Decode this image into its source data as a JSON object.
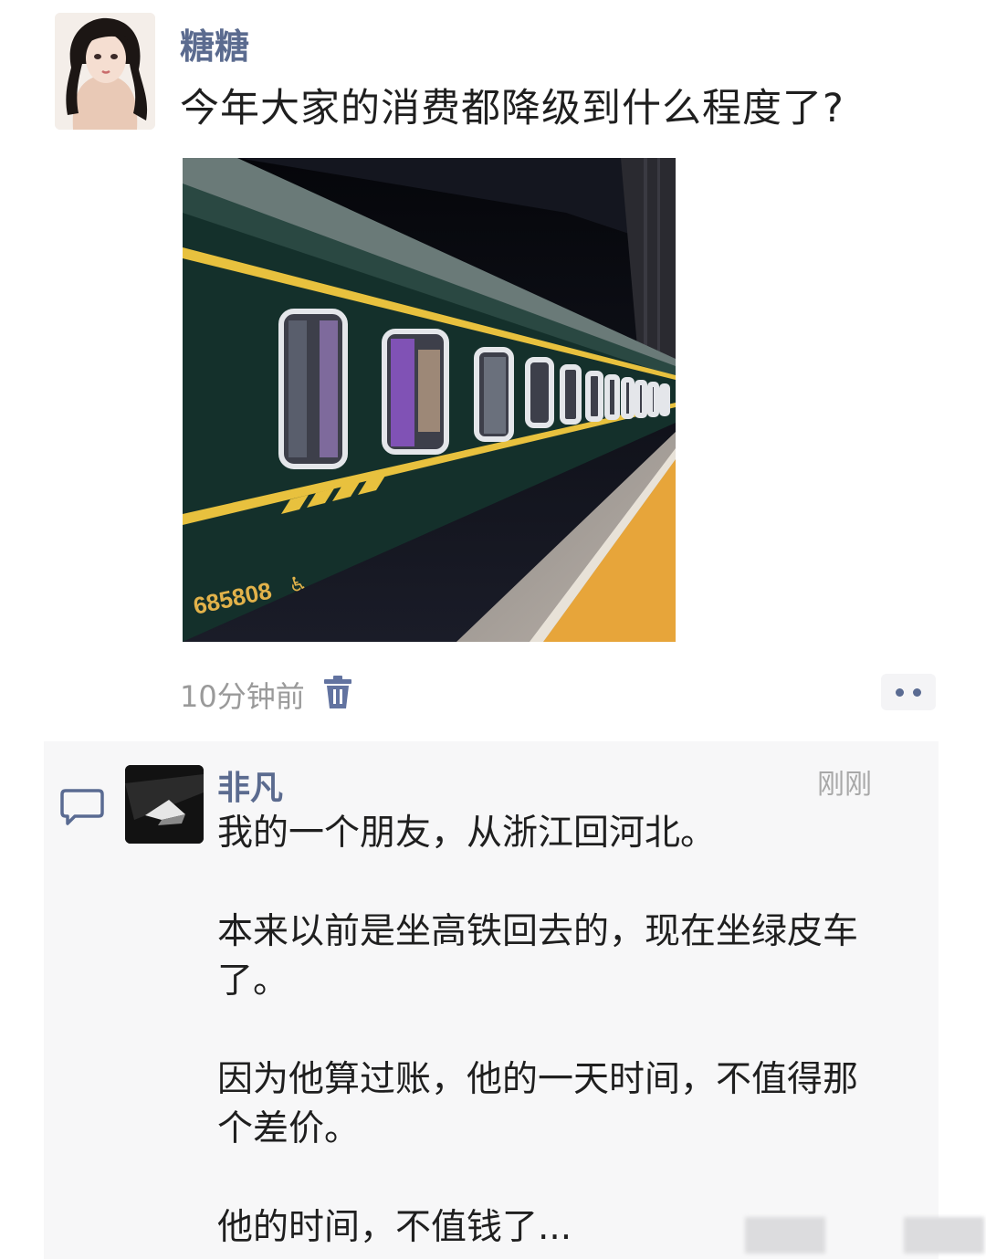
{
  "post": {
    "author": "糖糖",
    "text": "今年大家的消费都降级到什么程度了?",
    "time": "10分钟前",
    "photo": {
      "train_number": "685808"
    }
  },
  "comment": {
    "author": "非凡",
    "time": "刚刚",
    "paragraphs": [
      "我的一个朋友，从浙江回河北。",
      "本来以前是坐高铁回去的，现在坐绿皮车了。",
      "因为他算过账，他的一天时间，不值得那个差价。",
      "他的时间，不值钱了..."
    ]
  },
  "icons": {
    "trash": "trash-icon",
    "more": "more-icon",
    "comment": "comment-bubble-icon"
  },
  "colors": {
    "name": "#5b6b8f",
    "text": "#1f1f1f",
    "meta": "#9a9a9a",
    "train_body": "#14302b",
    "train_stripe": "#e8c13e"
  }
}
